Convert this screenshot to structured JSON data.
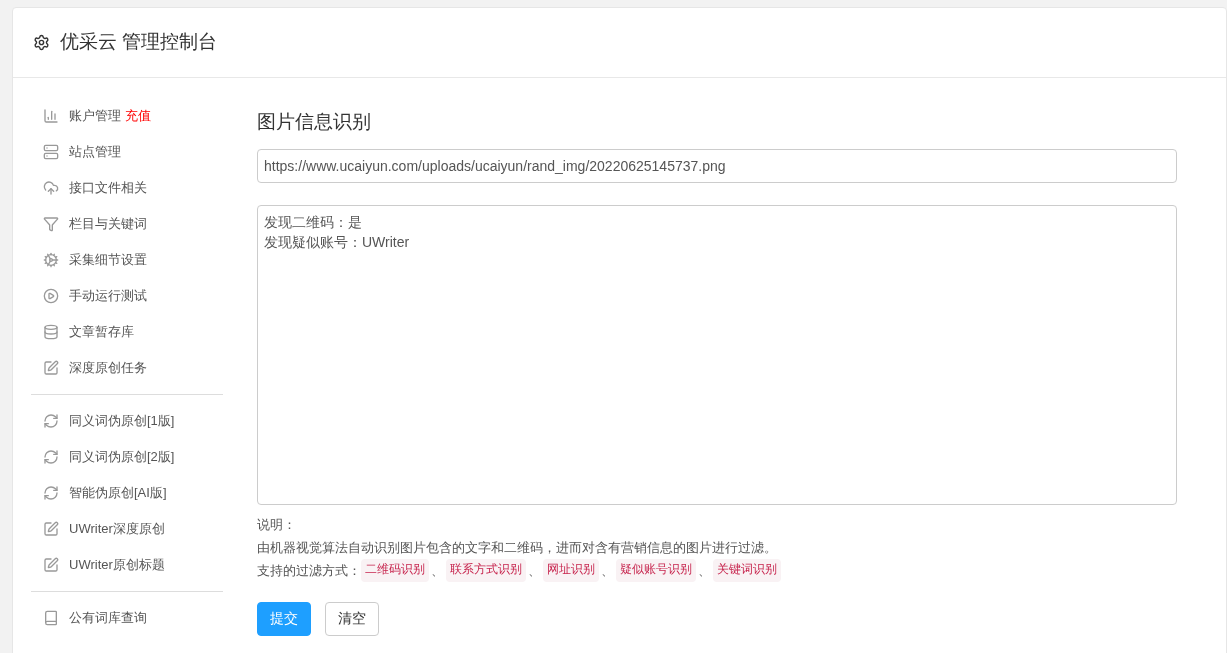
{
  "header": {
    "title": "优采云 管理控制台"
  },
  "sidebar": {
    "groups": [
      {
        "items": [
          {
            "label": "账户管理",
            "badge": "充值"
          },
          {
            "label": "站点管理"
          },
          {
            "label": "接口文件相关"
          },
          {
            "label": "栏目与关键词"
          },
          {
            "label": "采集细节设置"
          },
          {
            "label": "手动运行测试"
          },
          {
            "label": "文章暂存库"
          },
          {
            "label": "深度原创任务"
          }
        ]
      },
      {
        "items": [
          {
            "label": "同义词伪原创[1版]"
          },
          {
            "label": "同义词伪原创[2版]"
          },
          {
            "label": "智能伪原创[AI版]"
          },
          {
            "label": "UWriter深度原创"
          },
          {
            "label": "UWriter原创标题"
          }
        ]
      },
      {
        "items": [
          {
            "label": "公有词库查询"
          }
        ]
      }
    ]
  },
  "main": {
    "title": "图片信息识别",
    "url_field": {
      "value": "https://www.ucaiyun.com/uploads/ucaiyun/rand_img/20220625145737.png"
    },
    "result_box": {
      "lines": [
        "发现二维码：是",
        "发现疑似账号：UWriter"
      ]
    },
    "notes": {
      "heading": "说明：",
      "description": "由机器视觉算法自动识别图片包含的文字和二维码，进而对含有营销信息的图片进行过滤。",
      "methods_label": "支持的过滤方式：",
      "methods": [
        "二维码识别",
        "联系方式识别",
        "网址识别",
        "疑似账号识别",
        "关键词识别"
      ],
      "separator": "、"
    },
    "buttons": [
      {
        "label": "提交",
        "kind": "primary"
      },
      {
        "label": "清空",
        "kind": "default"
      }
    ]
  }
}
